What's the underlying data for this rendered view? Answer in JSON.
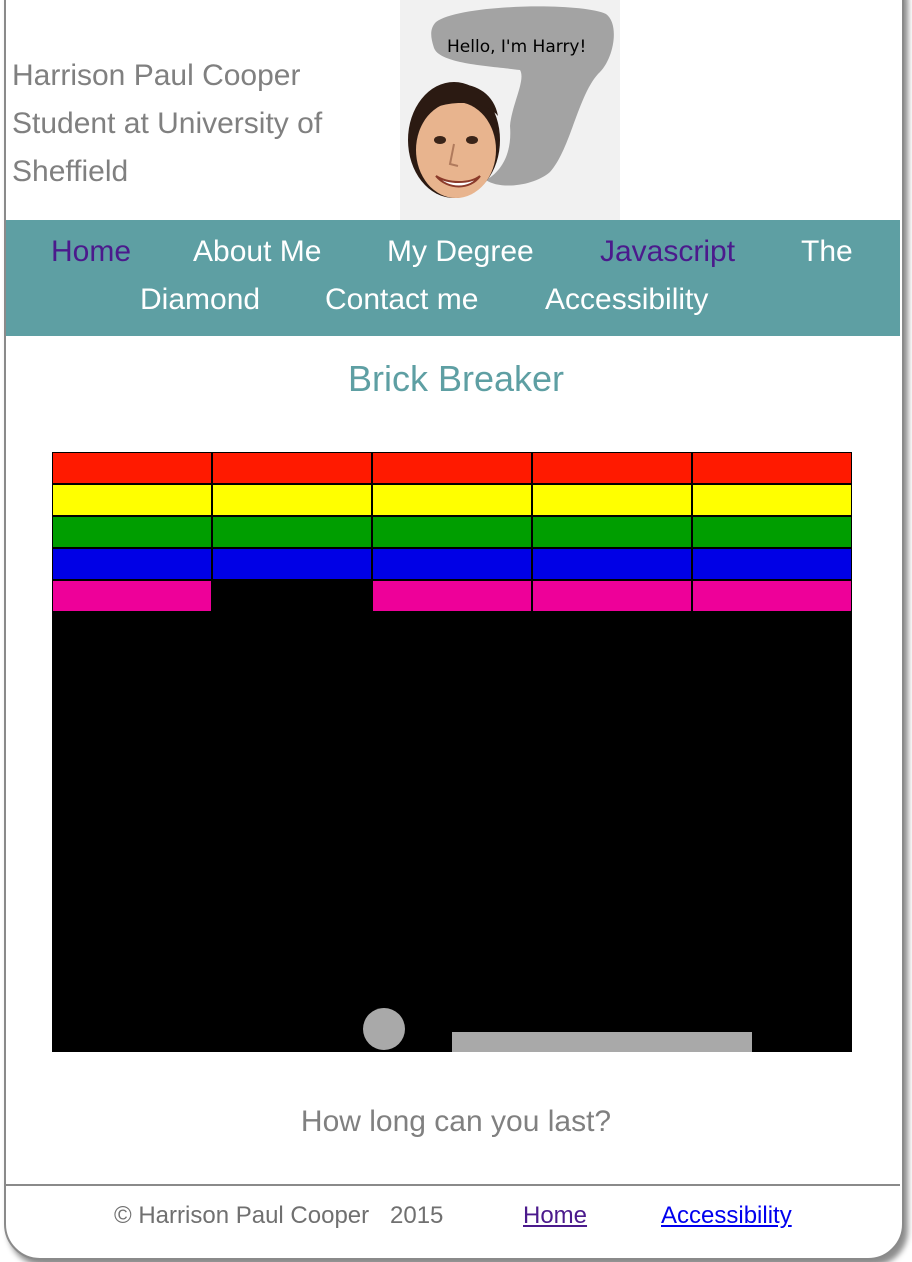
{
  "header": {
    "name_line1": "Harrison Paul Cooper",
    "name_line2": "Student at University of",
    "name_line3": "Sheffield",
    "speech_bubble": "Hello, I'm Harry!"
  },
  "nav": {
    "items": [
      {
        "label": "Home",
        "visited": true
      },
      {
        "label": "About Me",
        "visited": false
      },
      {
        "label": "My Degree",
        "visited": false
      },
      {
        "label": "Javascript",
        "visited": true
      },
      {
        "label": "The",
        "visited": false
      },
      {
        "label": "Diamond",
        "visited": false
      },
      {
        "label": "Contact me",
        "visited": false
      },
      {
        "label": "Accessibility",
        "visited": false
      }
    ]
  },
  "main": {
    "title": "Brick Breaker",
    "tagline": "How long can you last?"
  },
  "game": {
    "background": "#000000",
    "brick_columns": 5,
    "brick_rows": [
      {
        "color": "#ff1a00",
        "present": [
          true,
          true,
          true,
          true,
          true
        ]
      },
      {
        "color": "#ffff00",
        "present": [
          true,
          true,
          true,
          true,
          true
        ]
      },
      {
        "color": "#009e00",
        "present": [
          true,
          true,
          true,
          true,
          true
        ]
      },
      {
        "color": "#0000e6",
        "present": [
          true,
          true,
          true,
          true,
          true
        ]
      },
      {
        "color": "#ee0099",
        "present": [
          true,
          false,
          true,
          true,
          true
        ]
      }
    ],
    "ball_color": "#a9a9a9",
    "paddle_color": "#a9a9a9"
  },
  "footer": {
    "copyright": "© Harrison Paul Cooper",
    "year": "2015",
    "home_link": "Home",
    "accessibility_link": "Accessibility"
  },
  "colors": {
    "nav_background": "#5e9fa3",
    "title": "#5e9fa3",
    "visited_link": "#4b1a8c",
    "text_gray": "#808080"
  }
}
